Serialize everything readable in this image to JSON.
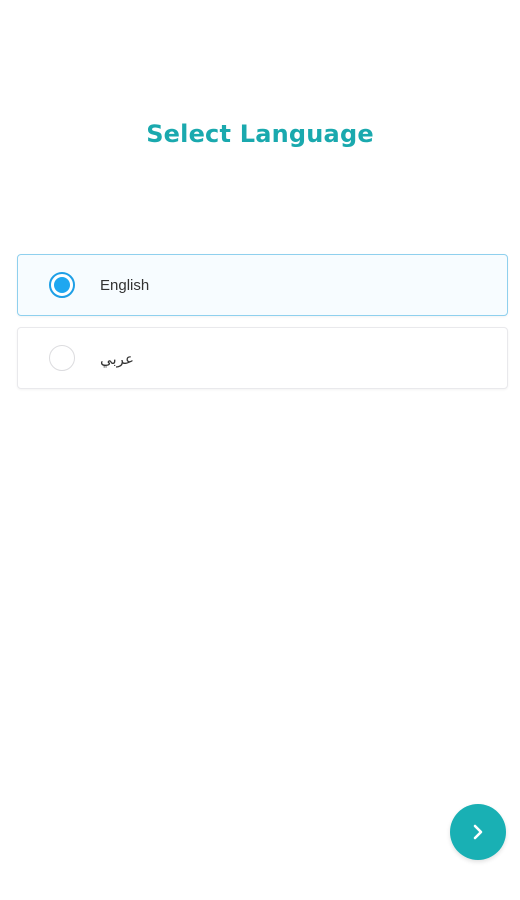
{
  "page": {
    "title": "Select Language"
  },
  "languages": [
    {
      "label": "English",
      "selected": true
    },
    {
      "label": "عربي",
      "selected": false
    }
  ],
  "next_button": {
    "icon": "chevron-right-icon"
  },
  "colors": {
    "accent": "#1aa9ae",
    "radio_selected": "#1ea7f0",
    "selected_border": "#8fd0ee",
    "next_button": "#19b0b4"
  }
}
